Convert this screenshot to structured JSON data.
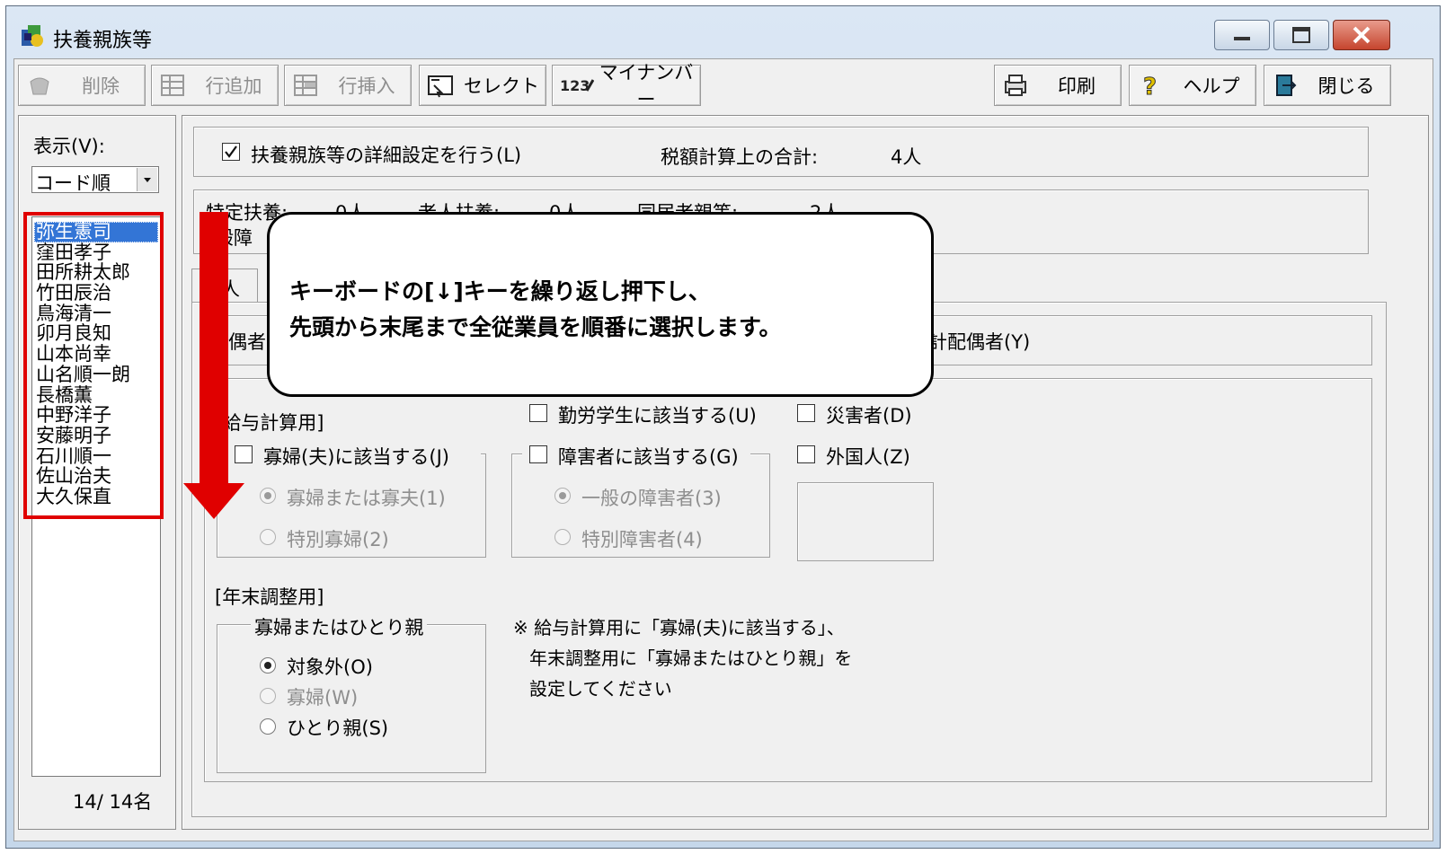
{
  "window": {
    "title": "扶養親族等"
  },
  "toolbar": {
    "delete": "削除",
    "add_row": "行追加",
    "insert_row": "行挿入",
    "select": "セレクト",
    "mynumber": "マイナンバー",
    "print": "印刷",
    "help": "ヘルプ",
    "close": "閉じる"
  },
  "sidebar": {
    "display_label": "表示(V):",
    "order_select": "コード順",
    "employees": [
      "弥生憲司",
      "窪田孝子",
      "田所耕太郎",
      "竹田辰治",
      "鳥海清一",
      "卯月良知",
      "山本尚幸",
      "山名順一朗",
      "長橋薫",
      "中野洋子",
      "安藤明子",
      "石川順一",
      "佐山治夫",
      "大久保直"
    ],
    "selected_index": 0,
    "count_text": "14/ 14名"
  },
  "main": {
    "detail_checkbox_label": "扶養親族等の詳細設定を行う(L)",
    "detail_checked": true,
    "tax_total_label": "税額計算上の合計:",
    "tax_total_value": "4人",
    "tokutei_label": "特定扶養:",
    "tokutei_value": "0人",
    "rojin_label": "老人扶養:",
    "rojin_value": "0人",
    "dokyo_label": "同居老親等:",
    "dokyo_value": "2人",
    "ippan_partial": "般障",
    "tab_partial": "人",
    "spouse_partial": "配偶者",
    "gokei_spouse_partial": "計配偶者(Y)",
    "salary_section": "[給与計算用]",
    "widow_check": "寡婦(夫)に該当する(J)",
    "widow_opt1": "寡婦または寡夫(1)",
    "widow_opt2": "特別寡婦(2)",
    "student_check": "勤労学生に該当する(U)",
    "disabled_check": "障害者に該当する(G)",
    "disabled_opt1": "一般の障害者(3)",
    "disabled_opt2": "特別障害者(4)",
    "disaster_check": "災害者(D)",
    "foreigner_check": "外国人(Z)",
    "year_end_section": "[年末調整用]",
    "single_group_title": "寡婦またはひとり親",
    "single_opt1": "対象外(O)",
    "single_opt2": "寡婦(W)",
    "single_opt3": "ひとり親(S)",
    "note_line1": "※ 給与計算用に「寡婦(夫)に該当する」、",
    "note_line2": "年末調整用に「寡婦またはひとり親」を",
    "note_line3": "設定してください"
  },
  "callout": {
    "line1": "キーボードの[↓]キーを繰り返し押下し、",
    "line2": "先頭から末尾まで全従業員を順番に選択します。"
  },
  "colors": {
    "highlight": "#e00000",
    "selection": "#3375d6"
  },
  "icons": [
    "app-icon",
    "minimize-icon",
    "maximize-icon",
    "close-icon",
    "delete-icon",
    "add-row-icon",
    "insert-row-icon",
    "select-icon",
    "mynumber-icon",
    "print-icon",
    "help-icon",
    "exit-icon",
    "dropdown-arrow-icon",
    "check-icon",
    "down-arrow-annotation"
  ]
}
